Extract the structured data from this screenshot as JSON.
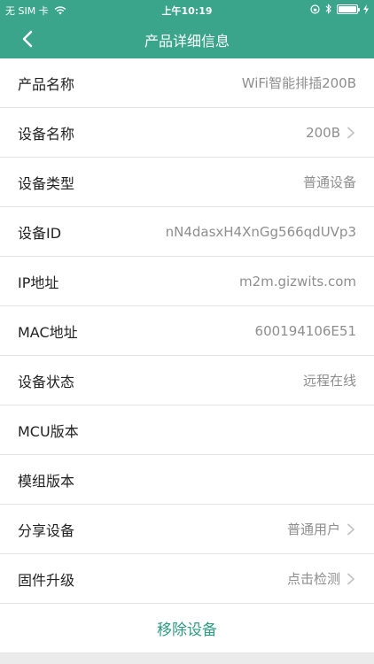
{
  "status_bar": {
    "carrier": "无 SIM 卡",
    "time": "上午10:19"
  },
  "nav": {
    "title": "产品详细信息"
  },
  "rows": [
    {
      "label": "产品名称",
      "value": "WiFi智能排插200B",
      "chevron": false
    },
    {
      "label": "设备名称",
      "value": "200B",
      "chevron": true
    },
    {
      "label": "设备类型",
      "value": "普通设备",
      "chevron": false
    },
    {
      "label": "设备ID",
      "value": "nN4dasxH4XnGg566qdUVp3",
      "chevron": false
    },
    {
      "label": "IP地址",
      "value": "m2m.gizwits.com",
      "chevron": false
    },
    {
      "label": "MAC地址",
      "value": "600194106E51",
      "chevron": false
    },
    {
      "label": "设备状态",
      "value": "远程在线",
      "chevron": false
    },
    {
      "label": "MCU版本",
      "value": "",
      "chevron": false
    },
    {
      "label": "模组版本",
      "value": "",
      "chevron": false
    },
    {
      "label": "分享设备",
      "value": "普通用户",
      "chevron": true
    },
    {
      "label": "固件升级",
      "value": "点击检测",
      "chevron": true
    }
  ],
  "remove_button": "移除设备",
  "colors": {
    "header": "#3aa58a",
    "accent_text": "#2e9b82"
  }
}
